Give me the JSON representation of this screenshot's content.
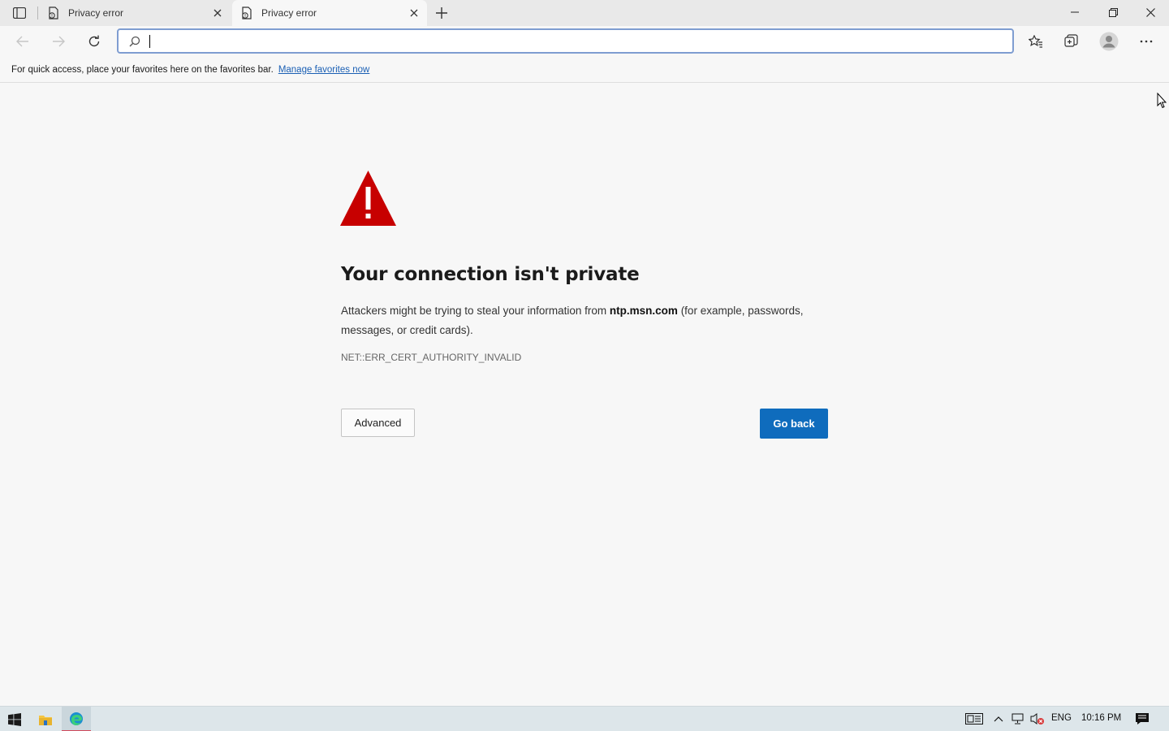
{
  "browser": {
    "tabs": [
      {
        "title": "Privacy error",
        "active": false
      },
      {
        "title": "Privacy error",
        "active": true
      }
    ],
    "address_bar": {
      "value": "",
      "placeholder": ""
    }
  },
  "favorites_bar": {
    "message": "For quick access, place your favorites here on the favorites bar.",
    "link_label": "Manage favorites now"
  },
  "error_page": {
    "heading": "Your connection isn't private",
    "description_prefix": "Attackers might be trying to steal your information from",
    "domain": "ntp.msn.com",
    "description_suffix": "(for example, passwords, messages, or credit cards).",
    "error_code": "NET::ERR_CERT_AUTHORITY_INVALID",
    "advanced_label": "Advanced",
    "go_back_label": "Go back",
    "warning_color": "#c70000",
    "accent_color": "#0f6cbd"
  },
  "taskbar": {
    "language": "ENG",
    "time": "10:16 PM"
  }
}
